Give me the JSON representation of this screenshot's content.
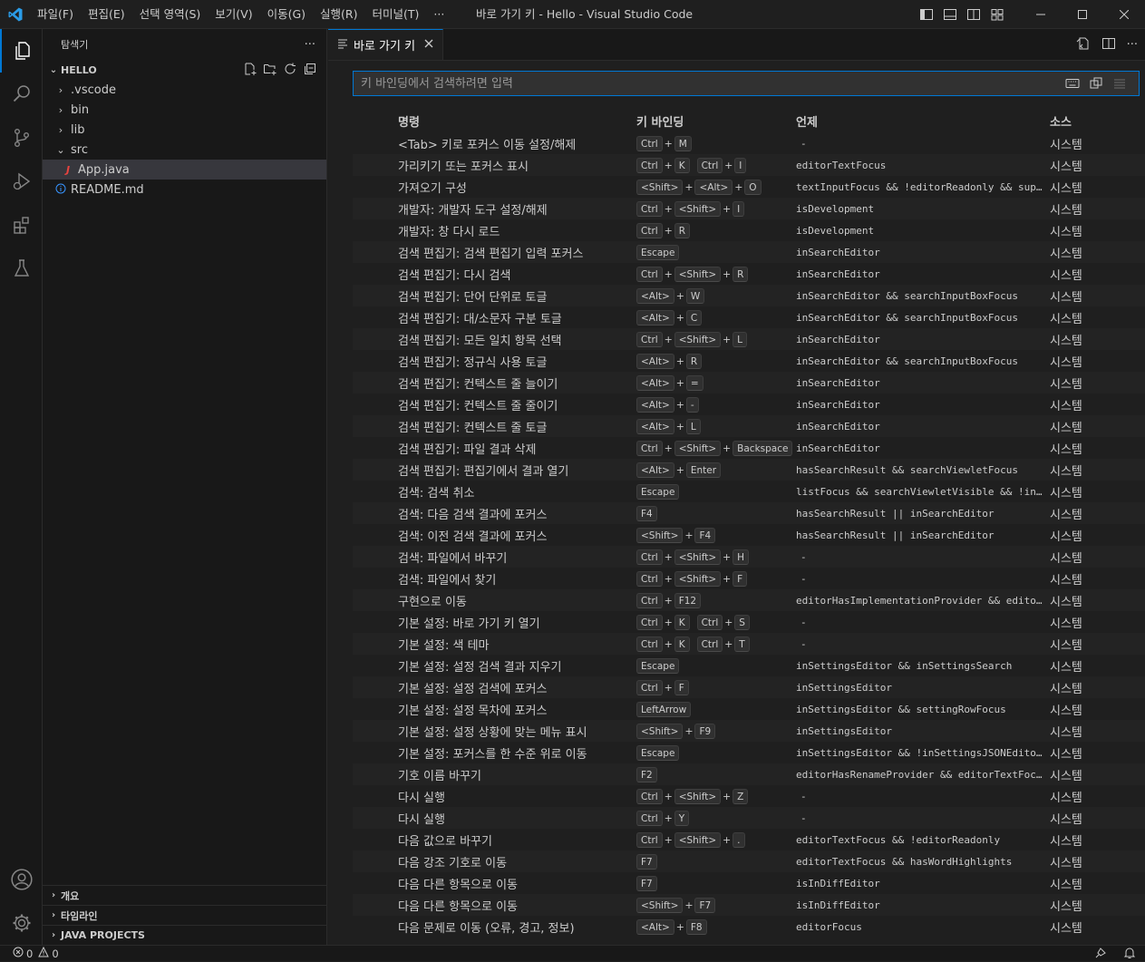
{
  "titlebar": {
    "menus": [
      "파일(F)",
      "편집(E)",
      "선택 영역(S)",
      "보기(V)",
      "이동(G)",
      "실행(R)",
      "터미널(T)",
      "···"
    ],
    "window_title": "바로 가기 키 - Hello - Visual Studio Code"
  },
  "sidebar": {
    "title": "탐색기",
    "more": "···",
    "project": "HELLO",
    "tree": [
      {
        "label": ".vscode",
        "type": "folder",
        "expanded": false,
        "depth": 1
      },
      {
        "label": "bin",
        "type": "folder",
        "expanded": false,
        "depth": 1
      },
      {
        "label": "lib",
        "type": "folder",
        "expanded": false,
        "depth": 1
      },
      {
        "label": "src",
        "type": "folder",
        "expanded": true,
        "depth": 1
      },
      {
        "label": "App.java",
        "type": "java",
        "depth": 2,
        "selected": true
      },
      {
        "label": "README.md",
        "type": "info",
        "depth": 1
      }
    ],
    "bottom_sections": [
      "개요",
      "타임라인",
      "JAVA PROJECTS"
    ]
  },
  "editor": {
    "tab_label": "바로 가기 키",
    "search_placeholder": "키 바인딩에서 검색하려면 입력",
    "columns": [
      "명령",
      "키 바인딩",
      "언제",
      "소스"
    ],
    "rows": [
      {
        "cmd": "<Tab> 키로 포커스 이동 설정/해제",
        "keys": [
          [
            "Ctrl",
            "M"
          ]
        ],
        "when": "-",
        "src": "시스템"
      },
      {
        "cmd": "가리키기 또는 포커스 표시",
        "keys": [
          [
            "Ctrl",
            "K"
          ],
          [
            "Ctrl",
            "I"
          ]
        ],
        "when": "editorTextFocus",
        "src": "시스템"
      },
      {
        "cmd": "가져오기 구성",
        "keys": [
          [
            "<Shift>",
            "<Alt>",
            "O"
          ]
        ],
        "when": "textInputFocus && !editorReadonly && sup…",
        "src": "시스템"
      },
      {
        "cmd": "개발자: 개발자 도구 설정/해제",
        "keys": [
          [
            "Ctrl",
            "<Shift>",
            "I"
          ]
        ],
        "when": "isDevelopment",
        "src": "시스템"
      },
      {
        "cmd": "개발자: 창 다시 로드",
        "keys": [
          [
            "Ctrl",
            "R"
          ]
        ],
        "when": "isDevelopment",
        "src": "시스템"
      },
      {
        "cmd": "검색 편집기: 검색 편집기 입력 포커스",
        "keys": [
          [
            "Escape"
          ]
        ],
        "when": "inSearchEditor",
        "src": "시스템"
      },
      {
        "cmd": "검색 편집기: 다시 검색",
        "keys": [
          [
            "Ctrl",
            "<Shift>",
            "R"
          ]
        ],
        "when": "inSearchEditor",
        "src": "시스템"
      },
      {
        "cmd": "검색 편집기: 단어 단위로 토글",
        "keys": [
          [
            "<Alt>",
            "W"
          ]
        ],
        "when": "inSearchEditor && searchInputBoxFocus",
        "src": "시스템"
      },
      {
        "cmd": "검색 편집기: 대/소문자 구분 토글",
        "keys": [
          [
            "<Alt>",
            "C"
          ]
        ],
        "when": "inSearchEditor && searchInputBoxFocus",
        "src": "시스템"
      },
      {
        "cmd": "검색 편집기: 모든 일치 항목 선택",
        "keys": [
          [
            "Ctrl",
            "<Shift>",
            "L"
          ]
        ],
        "when": "inSearchEditor",
        "src": "시스템"
      },
      {
        "cmd": "검색 편집기: 정규식 사용 토글",
        "keys": [
          [
            "<Alt>",
            "R"
          ]
        ],
        "when": "inSearchEditor && searchInputBoxFocus",
        "src": "시스템"
      },
      {
        "cmd": "검색 편집기: 컨텍스트 줄 늘이기",
        "keys": [
          [
            "<Alt>",
            "="
          ]
        ],
        "when": "inSearchEditor",
        "src": "시스템"
      },
      {
        "cmd": "검색 편집기: 컨텍스트 줄 줄이기",
        "keys": [
          [
            "<Alt>",
            "-"
          ]
        ],
        "when": "inSearchEditor",
        "src": "시스템"
      },
      {
        "cmd": "검색 편집기: 컨텍스트 줄 토글",
        "keys": [
          [
            "<Alt>",
            "L"
          ]
        ],
        "when": "inSearchEditor",
        "src": "시스템"
      },
      {
        "cmd": "검색 편집기: 파일 결과 삭제",
        "keys": [
          [
            "Ctrl",
            "<Shift>",
            "Backspace"
          ]
        ],
        "when": "inSearchEditor",
        "src": "시스템"
      },
      {
        "cmd": "검색 편집기: 편집기에서 결과 열기",
        "keys": [
          [
            "<Alt>",
            "Enter"
          ]
        ],
        "when": "hasSearchResult && searchViewletFocus",
        "src": "시스템"
      },
      {
        "cmd": "검색: 검색 취소",
        "keys": [
          [
            "Escape"
          ]
        ],
        "when": "listFocus && searchViewletVisible && !in…",
        "src": "시스템"
      },
      {
        "cmd": "검색: 다음 검색 결과에 포커스",
        "keys": [
          [
            "F4"
          ]
        ],
        "when": "hasSearchResult || inSearchEditor",
        "src": "시스템"
      },
      {
        "cmd": "검색: 이전 검색 결과에 포커스",
        "keys": [
          [
            "<Shift>",
            "F4"
          ]
        ],
        "when": "hasSearchResult || inSearchEditor",
        "src": "시스템"
      },
      {
        "cmd": "검색: 파일에서 바꾸기",
        "keys": [
          [
            "Ctrl",
            "<Shift>",
            "H"
          ]
        ],
        "when": "-",
        "src": "시스템"
      },
      {
        "cmd": "검색: 파일에서 찾기",
        "keys": [
          [
            "Ctrl",
            "<Shift>",
            "F"
          ]
        ],
        "when": "-",
        "src": "시스템"
      },
      {
        "cmd": "구현으로 이동",
        "keys": [
          [
            "Ctrl",
            "F12"
          ]
        ],
        "when": "editorHasImplementationProvider && edito…",
        "src": "시스템"
      },
      {
        "cmd": "기본 설정: 바로 가기 키 열기",
        "keys": [
          [
            "Ctrl",
            "K"
          ],
          [
            "Ctrl",
            "S"
          ]
        ],
        "when": "-",
        "src": "시스템"
      },
      {
        "cmd": "기본 설정: 색 테마",
        "keys": [
          [
            "Ctrl",
            "K"
          ],
          [
            "Ctrl",
            "T"
          ]
        ],
        "when": "-",
        "src": "시스템"
      },
      {
        "cmd": "기본 설정: 설정 검색 결과 지우기",
        "keys": [
          [
            "Escape"
          ]
        ],
        "when": "inSettingsEditor && inSettingsSearch",
        "src": "시스템"
      },
      {
        "cmd": "기본 설정: 설정 검색에 포커스",
        "keys": [
          [
            "Ctrl",
            "F"
          ]
        ],
        "when": "inSettingsEditor",
        "src": "시스템"
      },
      {
        "cmd": "기본 설정: 설정 목차에 포커스",
        "keys": [
          [
            "LeftArrow"
          ]
        ],
        "when": "inSettingsEditor && settingRowFocus",
        "src": "시스템"
      },
      {
        "cmd": "기본 설정: 설정 상황에 맞는 메뉴 표시",
        "keys": [
          [
            "<Shift>",
            "F9"
          ]
        ],
        "when": "inSettingsEditor",
        "src": "시스템"
      },
      {
        "cmd": "기본 설정: 포커스를 한 수준 위로 이동",
        "keys": [
          [
            "Escape"
          ]
        ],
        "when": "inSettingsEditor && !inSettingsJSONEdito…",
        "src": "시스템"
      },
      {
        "cmd": "기호 이름 바꾸기",
        "keys": [
          [
            "F2"
          ]
        ],
        "when": "editorHasRenameProvider && editorTextFoc…",
        "src": "시스템"
      },
      {
        "cmd": "다시 실행",
        "keys": [
          [
            "Ctrl",
            "<Shift>",
            "Z"
          ]
        ],
        "when": "-",
        "src": "시스템"
      },
      {
        "cmd": "다시 실행",
        "keys": [
          [
            "Ctrl",
            "Y"
          ]
        ],
        "when": "-",
        "src": "시스템"
      },
      {
        "cmd": "다음 값으로 바꾸기",
        "keys": [
          [
            "Ctrl",
            "<Shift>",
            "."
          ]
        ],
        "when": "editorTextFocus && !editorReadonly",
        "src": "시스템"
      },
      {
        "cmd": "다음 강조 기호로 이동",
        "keys": [
          [
            "F7"
          ]
        ],
        "when": "editorTextFocus && hasWordHighlights",
        "src": "시스템"
      },
      {
        "cmd": "다음 다른 항목으로 이동",
        "keys": [
          [
            "F7"
          ]
        ],
        "when": "isInDiffEditor",
        "src": "시스템"
      },
      {
        "cmd": "다음 다른 항목으로 이동",
        "keys": [
          [
            "<Shift>",
            "F7"
          ]
        ],
        "when": "isInDiffEditor",
        "src": "시스템"
      },
      {
        "cmd": "다음 문제로 이동 (오류, 경고, 정보)",
        "keys": [
          [
            "<Alt>",
            "F8"
          ]
        ],
        "when": "editorFocus",
        "src": "시스템"
      }
    ]
  },
  "statusbar": {
    "errors": "0",
    "warnings": "0"
  },
  "colors": {
    "accent": "#0078d4",
    "background": "#1f1f1f",
    "sidebar": "#181818",
    "java_icon": "#e8433f",
    "info_icon": "#3794ff"
  }
}
